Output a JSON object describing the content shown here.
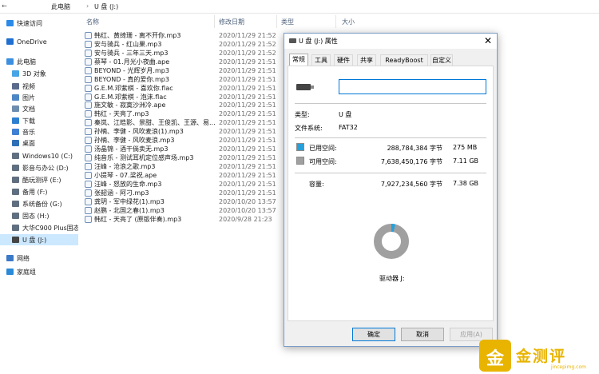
{
  "address": {
    "back": "←",
    "breadcrumb": [
      "此电脑",
      "U 盘 (J:)"
    ]
  },
  "sidebar": {
    "items": [
      {
        "label": "快速访问",
        "level": 1,
        "icon": "star-icon",
        "color": "#2b8ae8"
      },
      {
        "label": "OneDrive",
        "level": 1,
        "icon": "cloud-icon",
        "color": "#1f6fd0"
      },
      {
        "label": "此电脑",
        "level": 1,
        "icon": "computer-icon",
        "color": "#3c8fe0"
      },
      {
        "label": "3D 对象",
        "level": 2,
        "icon": "cube-icon",
        "color": "#48a4e4"
      },
      {
        "label": "视频",
        "level": 2,
        "icon": "video-icon",
        "color": "#5a6b8c"
      },
      {
        "label": "图片",
        "level": 2,
        "icon": "picture-icon",
        "color": "#4d86c4"
      },
      {
        "label": "文档",
        "level": 2,
        "icon": "document-icon",
        "color": "#6d8db0"
      },
      {
        "label": "下载",
        "level": 2,
        "icon": "download-icon",
        "color": "#2f7fd1"
      },
      {
        "label": "音乐",
        "level": 2,
        "icon": "music-icon",
        "color": "#3f7fd4"
      },
      {
        "label": "桌面",
        "level": 2,
        "icon": "desktop-icon",
        "color": "#2f6fb5"
      },
      {
        "label": "Windows10 (C:)",
        "level": 2,
        "icon": "drive-icon",
        "color": "#5f6f80"
      },
      {
        "label": "影音与办公 (D:)",
        "level": 2,
        "icon": "drive-icon",
        "color": "#5f6f80"
      },
      {
        "label": "酷玩测评 (E:)",
        "level": 2,
        "icon": "drive-icon",
        "color": "#5f6f80"
      },
      {
        "label": "备用 (F:)",
        "level": 2,
        "icon": "drive-icon",
        "color": "#5f6f80"
      },
      {
        "label": "系统备份 (G:)",
        "level": 2,
        "icon": "drive-icon",
        "color": "#5f6f80"
      },
      {
        "label": "固态 (H:)",
        "level": 2,
        "icon": "drive-icon",
        "color": "#5f6f80"
      },
      {
        "label": "大华C900 Plus固态",
        "level": 2,
        "icon": "drive-icon",
        "color": "#5f6f80"
      },
      {
        "label": "U 盘 (J:)",
        "level": 2,
        "icon": "usb-drive-icon",
        "color": "#444444",
        "selected": true
      },
      {
        "label": "网络",
        "level": 1,
        "icon": "network-icon",
        "color": "#3a79c8"
      },
      {
        "label": "家庭组",
        "level": 1,
        "icon": "homegroup-icon",
        "color": "#2a8ad8"
      }
    ]
  },
  "columns": {
    "name": "名称",
    "date": "修改日期",
    "type": "类型",
    "size": "大小"
  },
  "files": [
    {
      "name": "韩红、黄绮珊 - 离不开你.mp3",
      "date": "2020/11/29 21:52"
    },
    {
      "name": "安与骑兵 - 红山果.mp3",
      "date": "2020/11/29 21:52"
    },
    {
      "name": "安与骑兵 - 三年三天.mp3",
      "date": "2020/11/29 21:52"
    },
    {
      "name": "蔡琴 - 01.月光小夜曲.ape",
      "date": "2020/11/29 21:51"
    },
    {
      "name": "BEYOND - 光辉岁月.mp3",
      "date": "2020/11/29 21:51"
    },
    {
      "name": "BEYOND - 真的爱你.mp3",
      "date": "2020/11/29 21:51"
    },
    {
      "name": "G.E.M.邓紫棋 - 喜欢你.flac",
      "date": "2020/11/29 21:51"
    },
    {
      "name": "G.E.M.邓紫棋 - 泡沫.flac",
      "date": "2020/11/29 21:51"
    },
    {
      "name": "施文敏 - 寂寞沙洲冷.ape",
      "date": "2020/11/29 21:51"
    },
    {
      "name": "韩红 - 天亮了.mp3",
      "date": "2020/11/29 21:51"
    },
    {
      "name": "秦岚、江皓影、景甜、王俊凯、王源、易...",
      "date": "2020/11/29 21:51"
    },
    {
      "name": "孙楠、李健 - 风吹麦浪(1).mp3",
      "date": "2020/11/29 21:51"
    },
    {
      "name": "孙楠、李健 - 风吹麦浪.mp3",
      "date": "2020/11/29 21:51"
    },
    {
      "name": "汤晶锦 - 酒干倘卖无.mp3",
      "date": "2020/11/29 21:51"
    },
    {
      "name": "纯音乐 - 测试耳机定位感声场.mp3",
      "date": "2020/11/29 21:51"
    },
    {
      "name": "汪峰 - 沧浪之歌.mp3",
      "date": "2020/11/29 21:51"
    },
    {
      "name": "小提琴 - 07.梁祝.ape",
      "date": "2020/11/29 21:51"
    },
    {
      "name": "汪峰 - 怒放的生命.mp3",
      "date": "2020/11/29 21:51"
    },
    {
      "name": "张韶涵 - 阿刁.mp3",
      "date": "2020/11/29 21:51"
    },
    {
      "name": "龚玥 - 军中绿花(1).mp3",
      "date": "2020/10/20 13:57"
    },
    {
      "name": "赵鹏 - 北国之春(1).mp3",
      "date": "2020/10/20 13:57"
    },
    {
      "name": "韩红 - 天亮了 (原版伴奏).mp3",
      "date": "2020/9/28 21:23"
    }
  ],
  "dialog": {
    "title": "U 盘 (J:) 属性",
    "close": "✕",
    "tabs": [
      "常规",
      "工具",
      "硬件",
      "共享",
      "ReadyBoost",
      "自定义"
    ],
    "active_tab": "常规",
    "name_value": "",
    "type_label": "类型:",
    "type_value": "U 盘",
    "fs_label": "文件系统:",
    "fs_value": "FAT32",
    "used_label": "已用空间:",
    "used_bytes": "288,784,384 字节",
    "used_human": "275 MB",
    "used_color": "#26a0da",
    "free_label": "可用空间:",
    "free_bytes": "7,638,450,176 字节",
    "free_human": "7.11 GB",
    "free_color": "#a0a0a0",
    "cap_label": "容量:",
    "cap_bytes": "7,927,234,560 字节",
    "cap_human": "7.38 GB",
    "used_fraction": 0.0364,
    "drive_label": "驱动器 J:",
    "ok": "确定",
    "cancel": "取消",
    "apply": "应用(A)"
  },
  "watermark": {
    "badge": "金",
    "brand": "金测评",
    "site": "jincepimg.com",
    "color": "#e8b400"
  }
}
